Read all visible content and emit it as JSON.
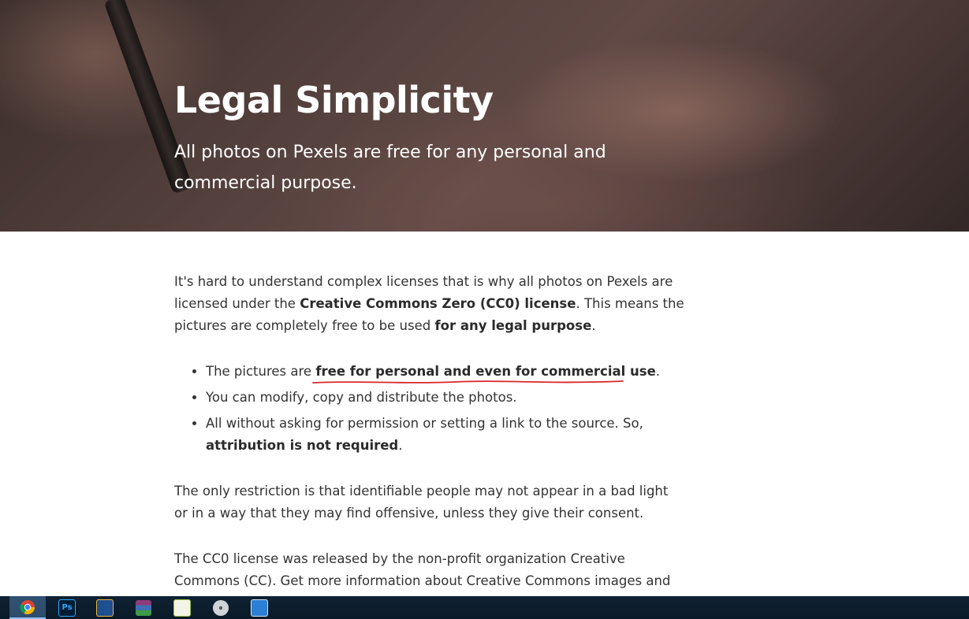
{
  "hero": {
    "title": "Legal Simplicity",
    "subtitle": "All photos on Pexels are free for any personal and commercial purpose."
  },
  "content": {
    "para1": {
      "t1": "It's hard to understand complex licenses that is why all photos on Pexels are licensed under the ",
      "b1": "Creative Commons Zero (CC0) license",
      "t2": ". This means the pictures are completely free to be used ",
      "b2": "for any legal purpose",
      "t3": "."
    },
    "bullets": {
      "b1_pre": "The pictures are ",
      "b1_bold": "free for personal and even for commercial use",
      "b1_post": ".",
      "b2": "You can modify, copy and distribute the photos.",
      "b3_pre": "All without asking for permission or setting a link to the source. So, ",
      "b3_bold": "attribution is not required",
      "b3_post": "."
    },
    "para2": "The only restriction is that identifiable people may not appear in a bad light or in a way that they may find offensive, unless they give their consent.",
    "para3": "The CC0 license was released by the non-profit organization Creative Commons (CC). Get more information about Creative Commons images and the license on"
  },
  "taskbar": {
    "items": [
      {
        "name": "chrome-icon",
        "label": ""
      },
      {
        "name": "photoshop-icon",
        "label": "Ps"
      },
      {
        "name": "app-icon",
        "label": ""
      },
      {
        "name": "archive-icon",
        "label": ""
      },
      {
        "name": "notepad-icon",
        "label": ""
      },
      {
        "name": "disc-icon",
        "label": ""
      },
      {
        "name": "photos-icon",
        "label": ""
      }
    ]
  },
  "colors": {
    "underline": "#d9262a",
    "taskbar": "#0f2233",
    "text": "#333333"
  }
}
